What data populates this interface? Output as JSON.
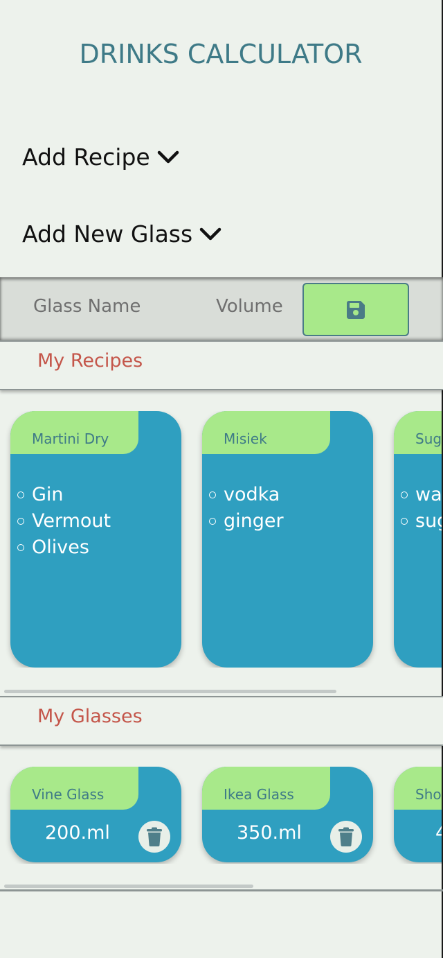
{
  "header": {
    "title": "DRINKS CALCULATOR"
  },
  "expanders": {
    "add_recipe": "Add Recipe",
    "add_glass": "Add New Glass"
  },
  "glass_form": {
    "name_placeholder": "Glass Name",
    "volume_placeholder": "Volume",
    "save_icon": "floppy-disk-icon"
  },
  "sections": {
    "recipes": "My Recipes",
    "glasses": "My Glasses"
  },
  "recipes": [
    {
      "name": "Martini Dry",
      "ingredients": [
        "Gin",
        "Vermout",
        "Olives"
      ]
    },
    {
      "name": "Misiek",
      "ingredients": [
        "vodka",
        "ginger"
      ]
    },
    {
      "name": "Sug",
      "ingredients": [
        "wa",
        "sug"
      ]
    }
  ],
  "glasses": [
    {
      "name": "Vine Glass",
      "volume": "200.ml"
    },
    {
      "name": "Ikea Glass",
      "volume": "350.ml"
    },
    {
      "name": "Sho",
      "volume": "4"
    }
  ],
  "colors": {
    "background": "#edf2ec",
    "title": "#3e7a87",
    "section_heading": "#c4564a",
    "card": "#2f9fc0",
    "card_tab": "#a8e98a"
  }
}
